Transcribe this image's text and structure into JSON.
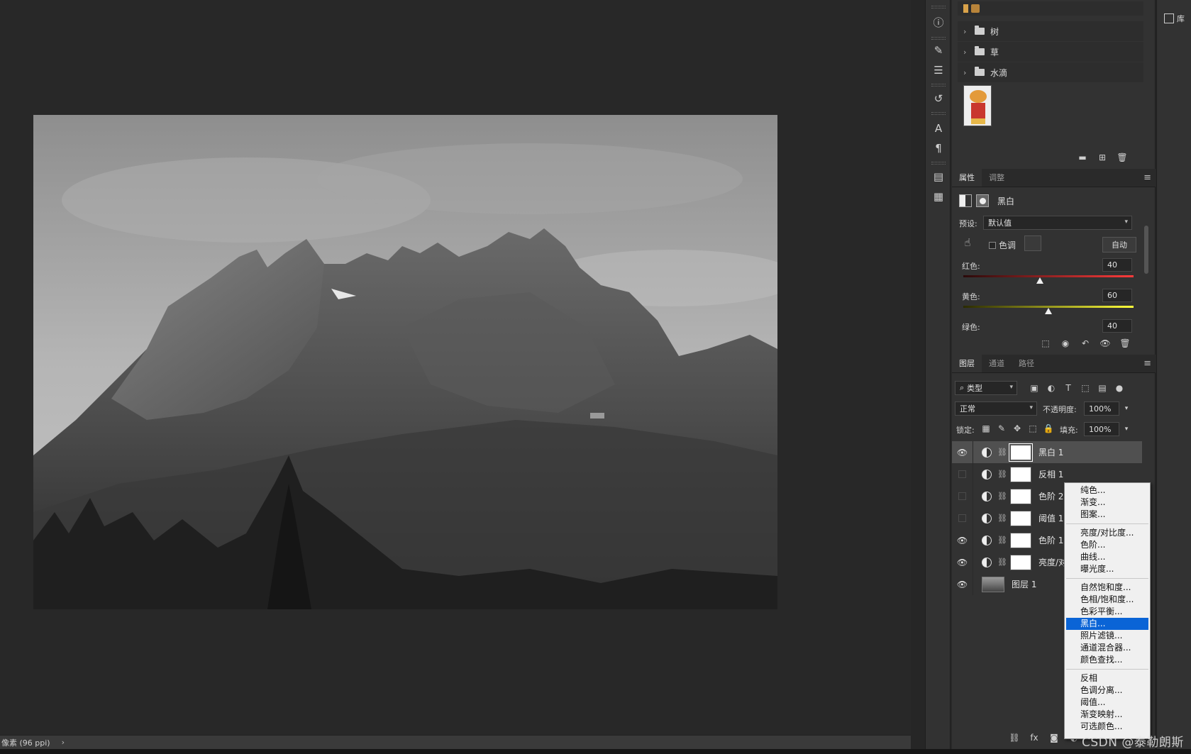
{
  "status_bar": {
    "text": "像素 (96 ppi)",
    "arrow": "›"
  },
  "library": {
    "folders": [
      {
        "label": "树"
      },
      {
        "label": "草"
      },
      {
        "label": "水滴"
      }
    ]
  },
  "properties": {
    "tabs": [
      "属性",
      "调整"
    ],
    "title": "黑白",
    "preset_label": "预设:",
    "preset_value": "默认值",
    "tint_label": "色调",
    "auto_button": "自动",
    "sliders": [
      {
        "label": "红色:",
        "value": "40",
        "fraction": 0.45,
        "color_from": "#2a0a0a",
        "color_to": "#ff3b3b"
      },
      {
        "label": "黄色:",
        "value": "60",
        "fraction": 0.5,
        "color_from": "#2a2a00",
        "color_to": "#ffff3b"
      },
      {
        "label": "绿色:",
        "value": "40"
      }
    ]
  },
  "layers_panel": {
    "tabs": [
      "图层",
      "通道",
      "路径"
    ],
    "filter_kind": "类型",
    "blend_mode": "正常",
    "opacity_label": "不透明度:",
    "opacity_value": "100%",
    "lock_label": "锁定:",
    "fill_label": "填充:",
    "fill_value": "100%",
    "layers": [
      {
        "name": "黑白 1",
        "visible": true,
        "selected": true,
        "type": "adjustment"
      },
      {
        "name": "反相 1",
        "visible": false,
        "selected": false,
        "type": "adjustment"
      },
      {
        "name": "色阶 2",
        "visible": false,
        "selected": false,
        "type": "adjustment"
      },
      {
        "name": "阈值 1",
        "visible": false,
        "selected": false,
        "type": "adjustment"
      },
      {
        "name": "色阶 1",
        "visible": true,
        "selected": false,
        "type": "adjustment"
      },
      {
        "name": "亮度/对比度 1",
        "visible": true,
        "selected": false,
        "type": "adjustment"
      },
      {
        "name": "图层 1",
        "visible": true,
        "selected": false,
        "type": "pixel"
      }
    ]
  },
  "context_menu": {
    "groups": [
      [
        "纯色...",
        "渐变...",
        "图案..."
      ],
      [
        "亮度/对比度...",
        "色阶...",
        "曲线...",
        "曝光度..."
      ],
      [
        "自然饱和度...",
        "色相/饱和度...",
        "色彩平衡...",
        "黑白...",
        "照片滤镜...",
        "通道混合器...",
        "颜色查找..."
      ],
      [
        "反相",
        "色调分离...",
        "阈值...",
        "渐变映射...",
        "可选颜色..."
      ]
    ],
    "highlighted": "黑白..."
  },
  "far_panel": {
    "label": "库"
  },
  "watermark": "CSDN @泰勒朗斯"
}
